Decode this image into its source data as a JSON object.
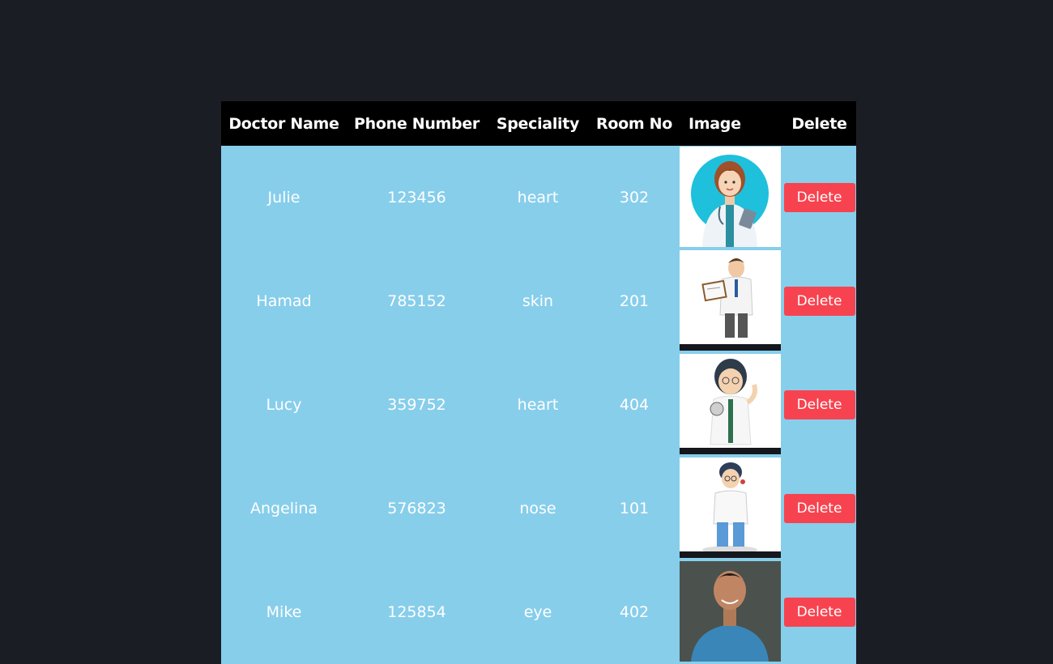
{
  "table": {
    "headers": {
      "name": "Doctor Name",
      "phone": "Phone Number",
      "speciality": "Speciality",
      "room": "Room No",
      "image": "Image",
      "delete": "Delete"
    },
    "rows": [
      {
        "name": "Julie",
        "phone": "123456",
        "speciality": "heart",
        "room": "302",
        "image": "female-doctor-cartoon",
        "delete_label": "Delete"
      },
      {
        "name": "Hamad",
        "phone": "785152",
        "speciality": "skin",
        "room": "201",
        "image": "male-doctor-clipboard-cartoon",
        "delete_label": "Delete"
      },
      {
        "name": "Lucy",
        "phone": "359752",
        "speciality": "heart",
        "room": "404",
        "image": "female-doctor-stethoscope-cartoon",
        "delete_label": "Delete"
      },
      {
        "name": "Angelina",
        "phone": "576823",
        "speciality": "nose",
        "room": "101",
        "image": "doctor-headset-cartoon",
        "delete_label": "Delete"
      },
      {
        "name": "Mike",
        "phone": "125854",
        "speciality": "eye",
        "room": "402",
        "image": "male-doctor-photo",
        "delete_label": "Delete"
      }
    ]
  },
  "colors": {
    "background": "#1b1d25",
    "header_bg": "#000000",
    "row_bg": "#87ceeb",
    "delete_button": "#f7434f"
  }
}
